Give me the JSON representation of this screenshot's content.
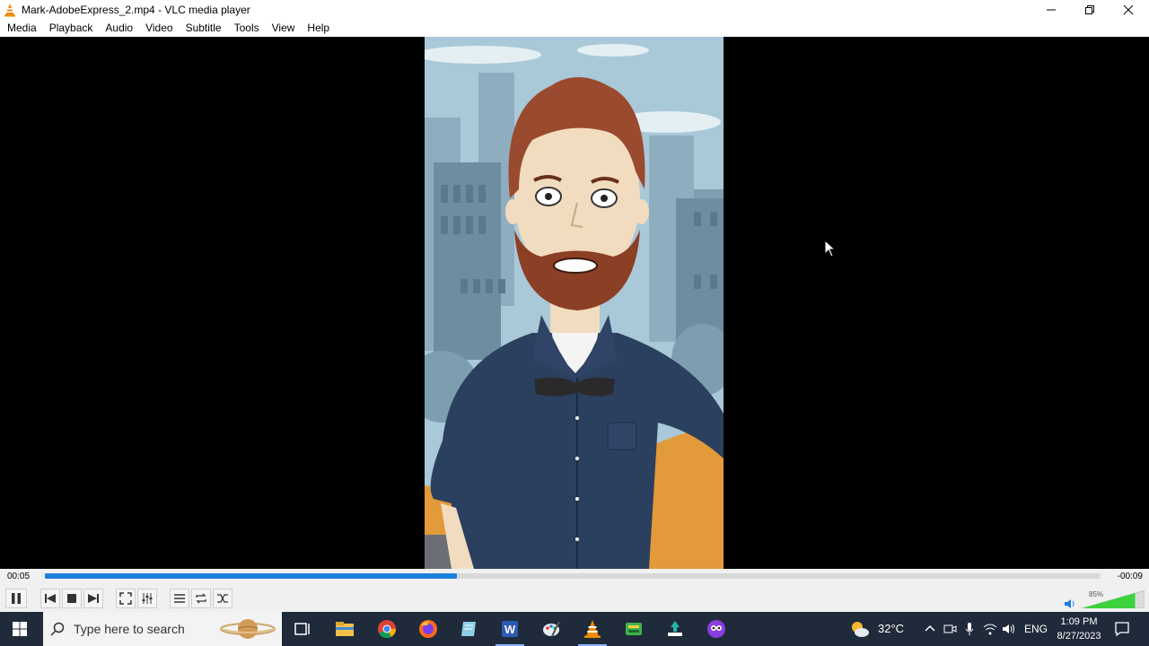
{
  "window": {
    "title": "Mark-AdobeExpress_2.mp4 - VLC media player",
    "icon": "vlc-cone-icon"
  },
  "menu": {
    "items": [
      "Media",
      "Playback",
      "Audio",
      "Video",
      "Subtitle",
      "Tools",
      "View",
      "Help"
    ]
  },
  "playback": {
    "elapsed": "00:05",
    "remaining": "-00:09",
    "progress_fraction": 0.39,
    "volume_label": "85%",
    "volume_fraction": 0.85,
    "state": "playing"
  },
  "taskbar": {
    "search_placeholder": "Type here to search",
    "weather_temp": "32°C",
    "language": "ENG",
    "time": "1:09 PM",
    "date": "8/27/2023",
    "apps": [
      "task-view-icon",
      "file-explorer-icon",
      "chrome-icon",
      "firefox-icon",
      "notepad-icon",
      "word-icon",
      "paint-icon",
      "vlc-icon",
      "app-green-icon",
      "app-installer-icon",
      "app-purple-icon"
    ]
  },
  "colors": {
    "seek_fill": "#1c7fe0",
    "taskbar_bg": "#1f2a3a",
    "vlc_orange": "#f08a00"
  }
}
